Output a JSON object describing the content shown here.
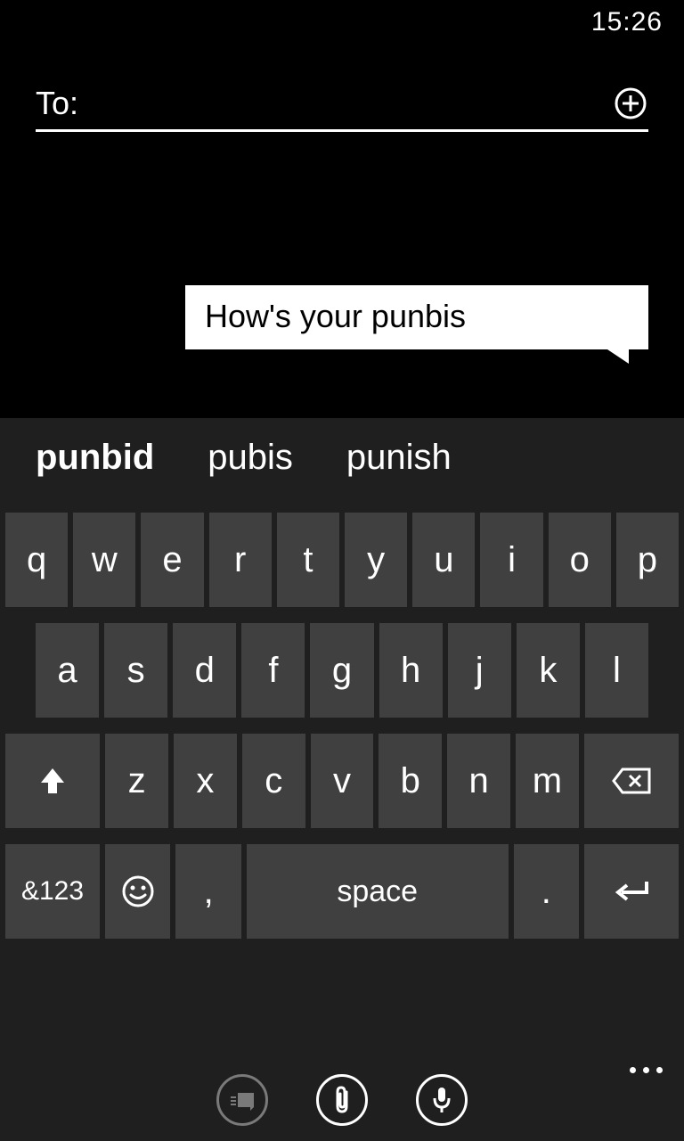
{
  "status": {
    "time": "15:26"
  },
  "compose": {
    "to_label": "To:",
    "to_value": ""
  },
  "message": {
    "text": "How's your punbis"
  },
  "suggestions": [
    "punbid",
    "pubis",
    "punish"
  ],
  "keyboard": {
    "row1": [
      "q",
      "w",
      "e",
      "r",
      "t",
      "y",
      "u",
      "i",
      "o",
      "p"
    ],
    "row2": [
      "a",
      "s",
      "d",
      "f",
      "g",
      "h",
      "j",
      "k",
      "l"
    ],
    "row3": [
      "z",
      "x",
      "c",
      "v",
      "b",
      "n",
      "m"
    ],
    "numkey": "&123",
    "comma": ",",
    "space": "space",
    "period": "."
  }
}
